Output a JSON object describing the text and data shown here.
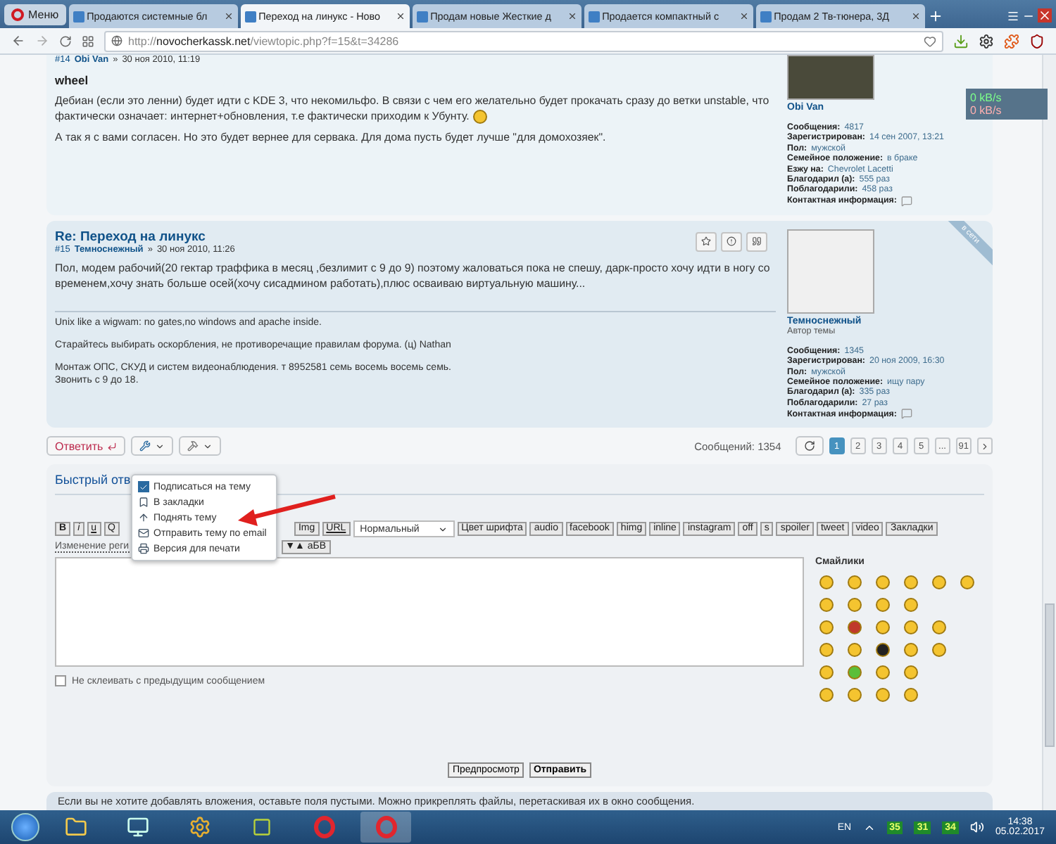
{
  "browser": {
    "menu_label": "Меню",
    "tabs": [
      {
        "title": "Продаются системные бл",
        "selected": false
      },
      {
        "title": "Переход на линукс - Ново",
        "selected": true
      },
      {
        "title": "Продам новые Жесткие д",
        "selected": false
      },
      {
        "title": "Продается компактный с",
        "selected": false
      },
      {
        "title": "Продам 2 Тв-тюнера, 3Д",
        "selected": false
      }
    ],
    "url_prefix": "http://",
    "url_host": "novocherkassk.net",
    "url_path": "/viewtopic.php?f=15&t=34286"
  },
  "network_widget": {
    "download": "0 kB/s",
    "upload": "0 kB/s"
  },
  "posts": [
    {
      "number": "#14",
      "author": "Obi Van",
      "separator": "»",
      "date": "30 ноя 2010, 11:19",
      "buttons": false,
      "body": [
        {
          "kind": "name",
          "text": "wheel"
        },
        {
          "kind": "text",
          "text": "Дебиан (если это ленни) будет идти с KDE 3, что некомильфо. В связи с чем его желательно будет прокачать сразу до ветки unstable, что фактически означает: интернет+обновления, т.е фактически приходим к Убунту.",
          "smiley": true
        },
        {
          "kind": "text",
          "text": "А так я с вами согласен. Но это будет вернее для сервака. Для дома пусть будет лучше \"для домохозяек\".",
          "smiley": false
        }
      ],
      "profile_name": "Obi Van",
      "profile": [
        {
          "label": "Сообщения:",
          "value": "4817"
        },
        {
          "label": "Зарегистрирован:",
          "value": "14 сен 2007, 13:21"
        },
        {
          "label": "Пол:",
          "value": "мужской"
        },
        {
          "label": "Семейное положение:",
          "value": "в браке"
        },
        {
          "label": "Езжу на:",
          "value": "Chevrolet Lacetti"
        },
        {
          "label": "Благодарил (а):",
          "value": "555 раз"
        },
        {
          "label": "Поблагодарили:",
          "value": "458 раз"
        },
        {
          "label": "Контактная информация:"
        }
      ]
    },
    {
      "title": "Re: Переход на линукс",
      "number": "#15",
      "author": "Темноснежный",
      "separator": "»",
      "date": "30 ноя 2010, 11:26",
      "ribbon": "в сети",
      "buttons": true,
      "body": [
        {
          "kind": "text",
          "text": "Пол, модем рабочий(20 гектар траффика в месяц ,безлимит с 9 до 9) поэтому жаловаться пока не спешу, дарк-просто хочу идти в ногу со временем,хочу знать больше осей(хочу сисадмином работать),плюс осваиваю виртуальную машину...",
          "smiley": false
        }
      ],
      "signature": [
        "Unix like a wigwam: no gates,no windows and apache inside.",
        "Старайтесь выбирать оскорбления, не противоречащие правилам форума. (ц) Nathan",
        "Монтаж ОПС, СКУД и систем видеонаблюдения. т 8952581 семь восемь восемь семь.\nЗвонить с 9 до 18."
      ],
      "profile_name": "Темноснежный",
      "rank": "Автор темы",
      "profile": [
        {
          "label": "Сообщения:",
          "value": "1345"
        },
        {
          "label": "Зарегистрирован:",
          "value": "20 ноя 2009, 16:30"
        },
        {
          "label": "Пол:",
          "value": "мужской"
        },
        {
          "label": "Семейное положение:",
          "value": "ищу пару"
        },
        {
          "label": "Благодарил (а):",
          "value": "335 раз"
        },
        {
          "label": "Поблагодарили:",
          "value": "27 раз"
        },
        {
          "label": "Контактная информация:"
        }
      ]
    }
  ],
  "actions": {
    "reply": "Ответить",
    "count": "Сообщений: 1354",
    "pages": [
      {
        "label": "1",
        "selected": true
      },
      {
        "label": "2",
        "selected": false
      },
      {
        "label": "3",
        "selected": false
      },
      {
        "label": "4",
        "selected": false
      },
      {
        "label": "5",
        "selected": false
      },
      {
        "label": "...",
        "selected": false
      },
      {
        "label": "91",
        "selected": false
      }
    ]
  },
  "tools_menu": [
    {
      "kind": "subscribe",
      "label": "Подписаться на тему",
      "checked": true
    },
    {
      "kind": "bookmark",
      "label": "В закладки"
    },
    {
      "kind": "bump",
      "label": "Поднять тему"
    },
    {
      "kind": "email",
      "label": "Отправить тему по email"
    },
    {
      "kind": "print",
      "label": "Версия для печати"
    }
  ],
  "quick_reply": {
    "title": "Быстрый отв",
    "toolbar_left": [
      "B",
      "i",
      "u",
      "Q"
    ],
    "toolbar_right": [
      "Img",
      "URL"
    ],
    "font_size": "Нормальный",
    "bbcodes": [
      "Цвет шрифта",
      "audio",
      "facebook",
      "himg",
      "inline",
      "instagram",
      "off",
      "s",
      "spoiler",
      "tweet",
      "video",
      "Закладки"
    ],
    "resize_label": "Изменение реги",
    "case_button": "▼▲ аБВ",
    "smilies_title": "Смайлики",
    "no_merge": {
      "label": "Не склеивать с предыдущим сообщением",
      "checked": false
    },
    "preview": "Предпросмотр",
    "submit": "Отправить",
    "note": "Если вы не хотите добавлять вложения, оставьте поля пустыми. Можно прикреплять файлы, перетаскивая их в окно сообщения."
  },
  "taskbar": {
    "language": "EN",
    "tray_counters": [
      "35",
      "31",
      "34"
    ],
    "time": "14:38",
    "date": "05.02.2017"
  }
}
